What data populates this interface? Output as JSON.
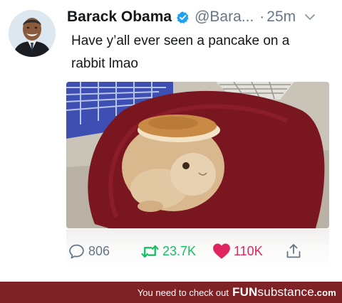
{
  "tweet": {
    "author": {
      "display_name": "Barack Obama",
      "handle": "@Bara...",
      "verified": true
    },
    "separator": "·",
    "time": "25m",
    "text": "Have y’all ever seen a pancake on a rabbit lmao",
    "media": {
      "description": "rabbit with pancake"
    },
    "actions": {
      "replies": "806",
      "retweets": "23.7K",
      "likes": "110K"
    }
  },
  "footer": {
    "text": "You need to check out",
    "brand_bold": "FUN",
    "brand_light": "substance",
    "tld": ".com"
  },
  "colors": {
    "retweet": "#17bf63",
    "like": "#e0245e",
    "verified": "#1da1f2",
    "footer_bg": "#7e2226",
    "muted": "#657786"
  }
}
